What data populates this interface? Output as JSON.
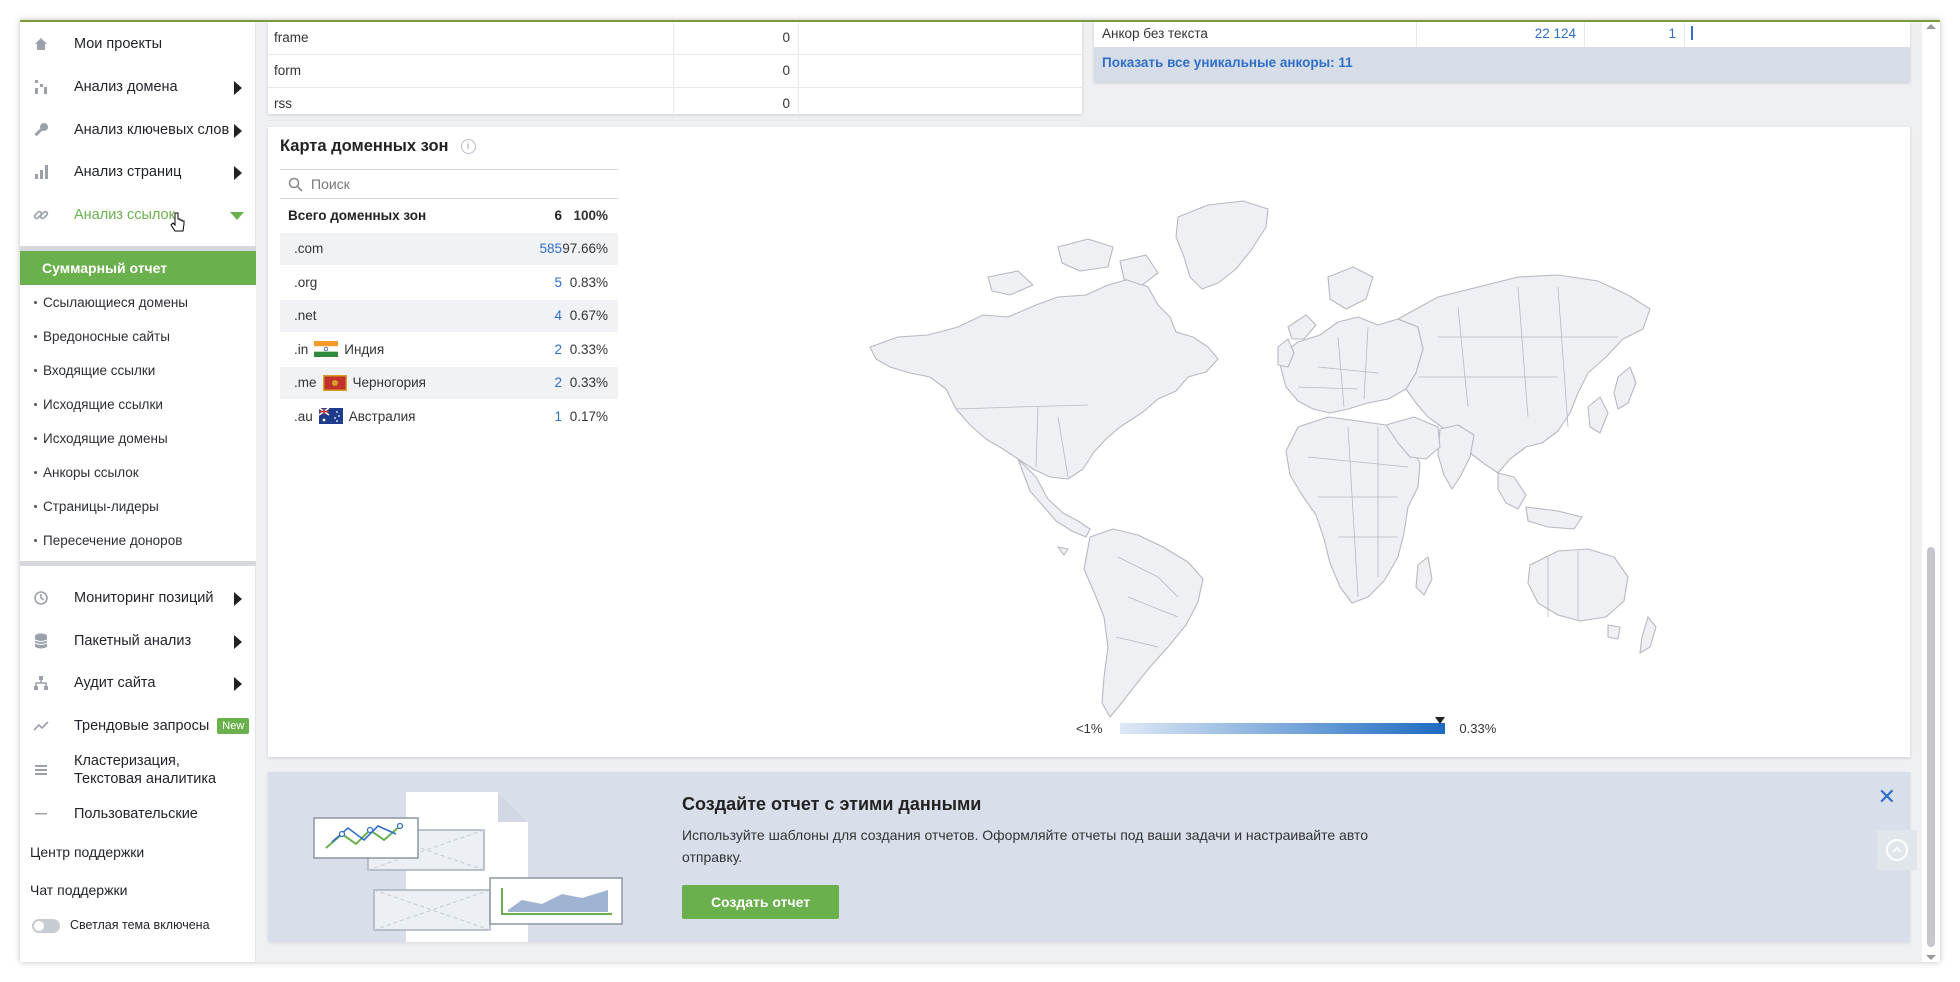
{
  "sidebar": {
    "items": [
      {
        "label": "Мои проекты",
        "icon": "home-icon"
      },
      {
        "label": "Анализ домена",
        "icon": "domain-chart-icon"
      },
      {
        "label": "Анализ ключевых слов",
        "icon": "key-icon"
      },
      {
        "label": "Анализ страниц",
        "icon": "bar-chart-icon"
      },
      {
        "label": "Анализ ссылок",
        "icon": "link-icon"
      }
    ],
    "submenu": {
      "active": "Суммарный отчет",
      "items": [
        "Ссылающиеся домены",
        "Вредоносные сайты",
        "Входящие ссылки",
        "Исходящие ссылки",
        "Исходящие домены",
        "Анкоры ссылок",
        "Страницы-лидеры",
        "Пересечение доноров"
      ]
    },
    "lower_items": [
      {
        "label": "Мониторинг позиций",
        "icon": "history-icon"
      },
      {
        "label": "Пакетный анализ",
        "icon": "database-icon"
      },
      {
        "label": "Аудит сайта",
        "icon": "sitemap-icon"
      },
      {
        "label": "Трендовые запросы",
        "icon": "trend-icon",
        "badge": "New"
      },
      {
        "label": "Кластеризация,",
        "label2": "Текстовая аналитика",
        "icon": "table-icon"
      },
      {
        "label": "Пользовательские",
        "icon": "dash-icon"
      }
    ],
    "support_center": "Центр поддержки",
    "support_chat": "Чат поддержки",
    "theme_label": "Светлая тема включена"
  },
  "top_left_table": {
    "rows": [
      {
        "name": "frame",
        "value": "0"
      },
      {
        "name": "form",
        "value": "0"
      },
      {
        "name": "rss",
        "value": "0"
      }
    ]
  },
  "top_right_table": {
    "row": {
      "name": "Анкор без текста",
      "count": "22 124",
      "num": "1"
    },
    "show_all": "Показать все уникальные анкоры: 11"
  },
  "domain_map": {
    "title": "Карта доменных зон",
    "search_placeholder": "Поиск",
    "total": {
      "label": "Всего доменных зон",
      "count": "6",
      "pct": "100%"
    },
    "zones": [
      {
        "zone": ".com",
        "country": "",
        "count": "585",
        "pct": "97.66%"
      },
      {
        "zone": ".org",
        "country": "",
        "count": "5",
        "pct": "0.83%"
      },
      {
        "zone": ".net",
        "country": "",
        "count": "4",
        "pct": "0.67%"
      },
      {
        "zone": ".in",
        "country": "Индия",
        "count": "2",
        "pct": "0.33%",
        "flag": "india"
      },
      {
        "zone": ".me",
        "country": "Черногория",
        "count": "2",
        "pct": "0.33%",
        "flag": "montenegro"
      },
      {
        "zone": ".au",
        "country": "Австралия",
        "count": "1",
        "pct": "0.17%",
        "flag": "australia"
      }
    ],
    "legend_min": "<1%",
    "legend_max": "0.33%",
    "colors": {
      "scale_start": "#dfe9f6",
      "scale_end": "#1d6bc1",
      "land": "#eef0f3",
      "border": "#b5bac2"
    }
  },
  "promo": {
    "title": "Создайте отчет с этими данными",
    "text": "Используйте шаблоны для создания отчетов. Оформляйте отчеты под ваши задачи и настраивайте авто отправку.",
    "button": "Создать отчет",
    "close": "✕"
  },
  "colors": {
    "accent_green": "#6ab04c",
    "link_blue": "#2f6fc7"
  }
}
